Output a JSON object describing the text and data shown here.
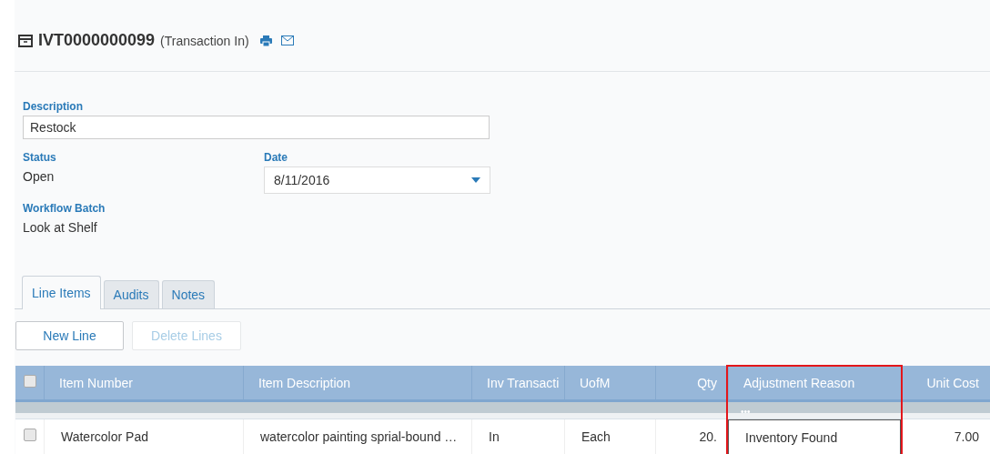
{
  "header": {
    "record_id": "IVT0000000099",
    "record_type": "(Transaction In)"
  },
  "form": {
    "description": {
      "label": "Description",
      "value": "Restock"
    },
    "status": {
      "label": "Status",
      "value": "Open"
    },
    "date": {
      "label": "Date",
      "value": "8/11/2016"
    },
    "workflow_batch": {
      "label": "Workflow Batch",
      "value": "Look at Shelf"
    }
  },
  "tabs": [
    {
      "label": "Line Items",
      "selected": true
    },
    {
      "label": "Audits",
      "selected": false
    },
    {
      "label": "Notes",
      "selected": false
    }
  ],
  "buttons": [
    {
      "label": "New Line",
      "disabled": false
    },
    {
      "label": "Delete Lines",
      "disabled": true
    }
  ],
  "table": {
    "select_all_checked": false,
    "filter_menu": "•••",
    "columns": [
      {
        "label": "Item Number",
        "highlighted": false
      },
      {
        "label": "Item Description",
        "highlighted": false
      },
      {
        "label": "Inv Transacti",
        "highlighted": false
      },
      {
        "label": "UofM",
        "highlighted": false
      },
      {
        "label": "Qty",
        "highlighted": false
      },
      {
        "label": "Adjustment Reason",
        "highlighted": true
      },
      {
        "label": "Unit Cost",
        "highlighted": false
      }
    ],
    "rows": [
      {
        "checked": false,
        "cells": [
          "Watercolor Pad",
          "watercolor painting sprial-bound …",
          "In",
          "Each",
          "20.",
          "Inventory Found",
          "7.00"
        ]
      }
    ]
  }
}
